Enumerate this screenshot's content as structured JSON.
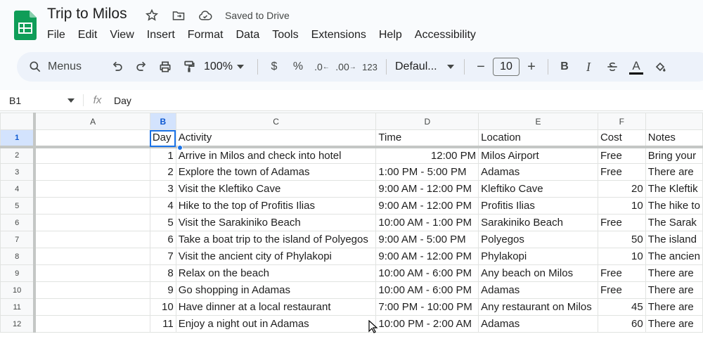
{
  "app": {
    "title": "Trip to Milos",
    "saved_status": "Saved to Drive",
    "brand_color": "#0f9d58"
  },
  "menu": [
    "File",
    "Edit",
    "View",
    "Insert",
    "Format",
    "Data",
    "Tools",
    "Extensions",
    "Help",
    "Accessibility"
  ],
  "toolbar": {
    "search_label": "Menus",
    "zoom": "100%",
    "currency": "$",
    "percent": "%",
    "dec_decrease": ".0",
    "dec_increase": ".00",
    "number_format": "123",
    "font": "Defaul...",
    "font_size": "10",
    "minus": "−",
    "plus": "+",
    "bold": "B",
    "italic": "I",
    "text_color": "A"
  },
  "formula_bar": {
    "cell_ref": "B1",
    "fx": "fx",
    "value": "Day"
  },
  "columns": [
    "",
    "A",
    "B",
    "C",
    "D",
    "E",
    "F",
    ""
  ],
  "header_row": {
    "num": "1",
    "cells": [
      "",
      "Day",
      "Activity",
      "Time",
      "Location",
      "Cost",
      "Notes"
    ]
  },
  "rows": [
    {
      "num": "2",
      "day": "1",
      "activity": "Arrive in Milos and check into hotel",
      "time": "12:00 PM",
      "location": "Milos Airport",
      "cost": "Free",
      "notes": "Bring your"
    },
    {
      "num": "3",
      "day": "2",
      "activity": "Explore the town of Adamas",
      "time": "1:00 PM - 5:00 PM",
      "location": "Adamas",
      "cost": "Free",
      "notes": "There are"
    },
    {
      "num": "4",
      "day": "3",
      "activity": "Visit the Kleftiko Cave",
      "time": "9:00 AM - 12:00 PM",
      "location": "Kleftiko Cave",
      "cost": "20",
      "notes": "The Kleftik"
    },
    {
      "num": "5",
      "day": "4",
      "activity": "Hike to the top of Profitis Ilias",
      "time": "9:00 AM - 12:00 PM",
      "location": "Profitis Ilias",
      "cost": "10",
      "notes": "The hike to"
    },
    {
      "num": "6",
      "day": "5",
      "activity": "Visit the Sarakiniko Beach",
      "time": "10:00 AM - 1:00 PM",
      "location": "Sarakiniko Beach",
      "cost": "Free",
      "notes": "The Sarak"
    },
    {
      "num": "7",
      "day": "6",
      "activity": "Take a boat trip to the island of Polyegos",
      "time": "9:00 AM - 5:00 PM",
      "location": "Polyegos",
      "cost": "50",
      "notes": "The island"
    },
    {
      "num": "8",
      "day": "7",
      "activity": "Visit the ancient city of Phylakopi",
      "time": "9:00 AM - 12:00 PM",
      "location": "Phylakopi",
      "cost": "10",
      "notes": "The ancien"
    },
    {
      "num": "9",
      "day": "8",
      "activity": "Relax on the beach",
      "time": "10:00 AM - 6:00 PM",
      "location": "Any beach on Milos",
      "cost": "Free",
      "notes": "There are"
    },
    {
      "num": "10",
      "day": "9",
      "activity": "Go shopping in Adamas",
      "time": "10:00 AM - 6:00 PM",
      "location": "Adamas",
      "cost": "Free",
      "notes": "There are"
    },
    {
      "num": "11",
      "day": "10",
      "activity": "Have dinner at a local restaurant",
      "time": "7:00 PM - 10:00 PM",
      "location": "Any restaurant on Milos",
      "cost": "45",
      "notes": "There are"
    },
    {
      "num": "12",
      "day": "11",
      "activity": "Enjoy a night out in Adamas",
      "time": "10:00 PM - 2:00 AM",
      "location": "Adamas",
      "cost": "60",
      "notes": "There are"
    }
  ]
}
